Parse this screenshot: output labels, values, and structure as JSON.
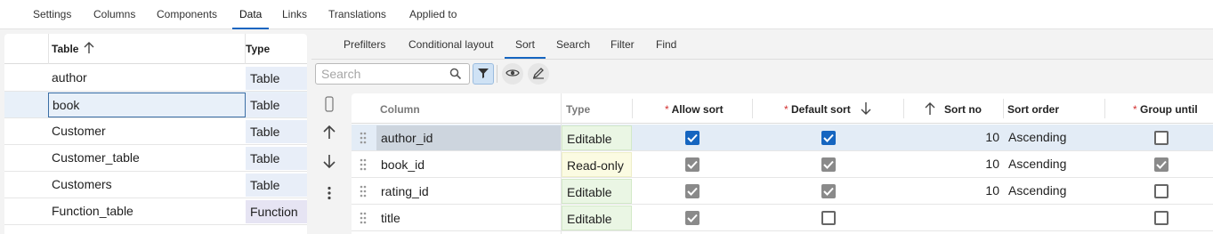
{
  "top_tabs": [
    "Settings",
    "Columns",
    "Components",
    "Data",
    "Links",
    "Translations",
    "Applied to"
  ],
  "top_active": "Data",
  "left_panel": {
    "col_table": "Table",
    "col_type": "Type",
    "rows": [
      {
        "name": "author",
        "type": "Table"
      },
      {
        "name": "book",
        "type": "Table"
      },
      {
        "name": "Customer",
        "type": "Table"
      },
      {
        "name": "Customer_table",
        "type": "Table"
      },
      {
        "name": "Customers",
        "type": "Table"
      },
      {
        "name": "Function_table",
        "type": "Function"
      }
    ],
    "selected": "book"
  },
  "sub_tabs": [
    "Prefilters",
    "Conditional layout",
    "Sort",
    "Search",
    "Filter",
    "Find"
  ],
  "sub_active": "Sort",
  "search": {
    "placeholder": "Search"
  },
  "grid": {
    "headers": {
      "column": "Column",
      "type": "Type",
      "allow_sort": "Allow sort",
      "default_sort": "Default sort",
      "sort_no": "Sort no",
      "sort_order": "Sort order",
      "group_until": "Group until",
      "required_mark": "*"
    },
    "rows": [
      {
        "column": "author_id",
        "type": "Editable",
        "allow_sort": "checked-blue",
        "default_sort": "checked-blue",
        "sort_no": "10",
        "sort_order": "Ascending",
        "group_until": "unchecked"
      },
      {
        "column": "book_id",
        "type": "Read-only",
        "allow_sort": "checked-grey",
        "default_sort": "checked-grey",
        "sort_no": "10",
        "sort_order": "Ascending",
        "group_until": "checked-grey"
      },
      {
        "column": "rating_id",
        "type": "Editable",
        "allow_sort": "checked-grey",
        "default_sort": "checked-grey",
        "sort_no": "10",
        "sort_order": "Ascending",
        "group_until": "unchecked"
      },
      {
        "column": "title",
        "type": "Editable",
        "allow_sort": "checked-grey",
        "default_sort": "unchecked",
        "sort_no": "",
        "sort_order": "",
        "group_until": "unchecked"
      }
    ]
  },
  "colors": {
    "accent": "#1565c0",
    "editable_bg": "#eaf6e4",
    "readonly_bg": "#fbfbe2",
    "required": "#d32f2f"
  }
}
